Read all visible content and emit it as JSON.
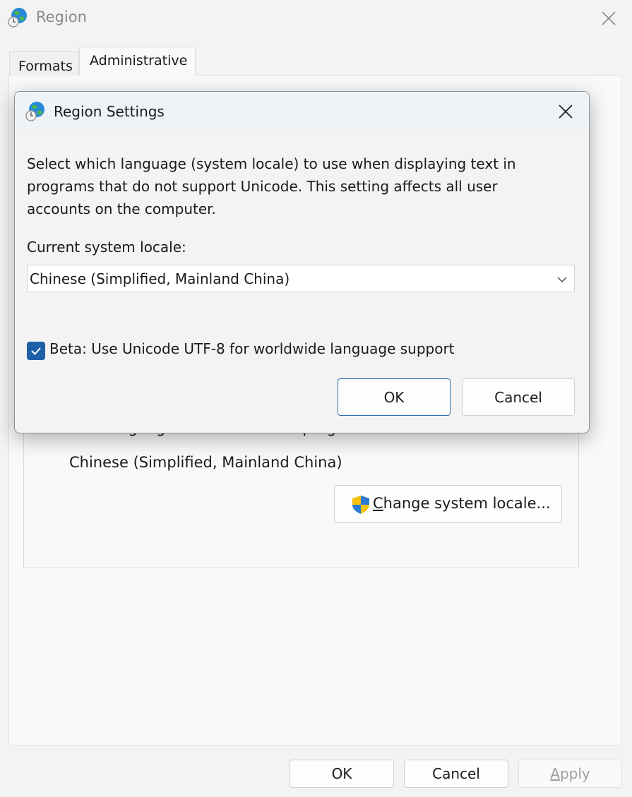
{
  "window": {
    "title": "Region",
    "icon": "globe-clock-icon",
    "close_icon": "close-icon"
  },
  "tabs": [
    {
      "label": "Formats",
      "selected": false
    },
    {
      "label": "Administrative",
      "selected": true
    }
  ],
  "background": {
    "caption": "Current language for non-Unicode programs:",
    "current_locale": "Chinese (Simplified, Mainland China)",
    "change_button": {
      "mnemonic": "C",
      "label_rest": "hange system locale...",
      "icon": "uac-shield-icon"
    }
  },
  "footer": {
    "ok": "OK",
    "cancel": "Cancel",
    "apply": {
      "mnemonic": "A",
      "rest": "pply",
      "enabled": false
    }
  },
  "dialog": {
    "title": "Region Settings",
    "icon": "globe-clock-icon",
    "description": "Select which language (system locale) to use when displaying text in programs that do not support Unicode. This setting affects all user accounts on the computer.",
    "locale_label": "Current system locale:",
    "locale_value": "Chinese (Simplified, Mainland China)",
    "beta_checkbox": {
      "label": "Beta: Use Unicode UTF-8 for worldwide language support",
      "checked": true
    },
    "ok": "OK",
    "cancel": "Cancel"
  },
  "colors": {
    "accent": "#1f5fa8",
    "window_bg": "#f3f3f3",
    "dialog_titlebar": "#eef3f7"
  }
}
